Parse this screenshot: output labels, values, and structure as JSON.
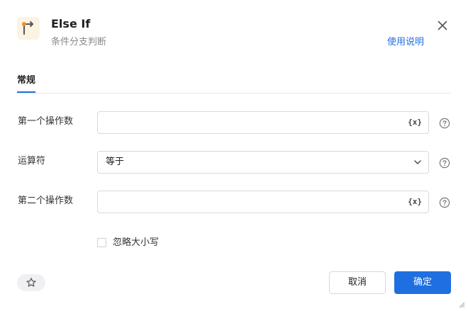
{
  "header": {
    "icon": "branch-icon",
    "title": "Else If",
    "subtitle": "条件分支判断",
    "help_link": "使用说明",
    "close_icon": "close-icon"
  },
  "tabs": [
    {
      "label": "常规",
      "active": true
    }
  ],
  "form": {
    "operand1": {
      "label": "第一个操作数",
      "value": "",
      "icon_text": "{x}"
    },
    "operator": {
      "label": "运算符",
      "value": "等于"
    },
    "operand2": {
      "label": "第二个操作数",
      "value": "",
      "icon_text": "{x}"
    },
    "ignore_case": {
      "label": "忽略大小写",
      "checked": false
    }
  },
  "footer": {
    "favorite_icon": "star-icon",
    "cancel_label": "取消",
    "ok_label": "确定"
  },
  "colors": {
    "accent": "#1f6fe0",
    "icon_bg": "#fdf3e3",
    "icon_orange": "#f08c2e"
  }
}
